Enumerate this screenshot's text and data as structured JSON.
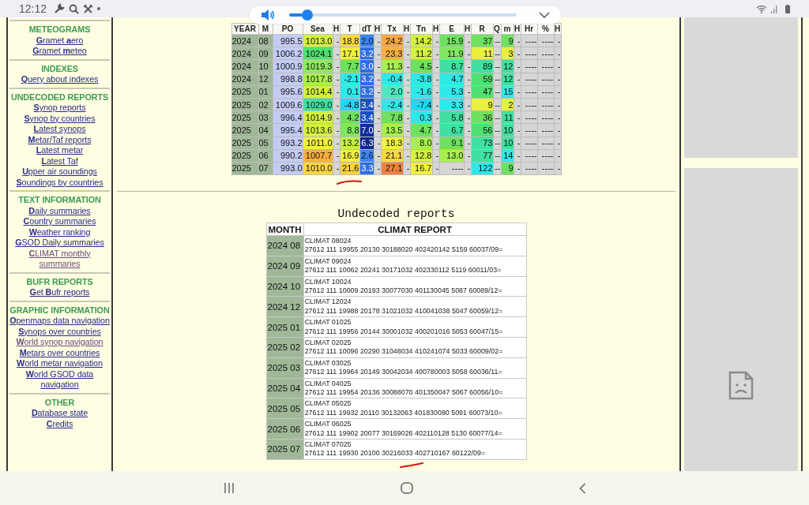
{
  "status_bar": {
    "time": "12:12"
  },
  "volume_popup": {
    "level": 0.06
  },
  "sidebar": {
    "sections": [
      {
        "title": "METEOGRAMS",
        "links": [
          {
            "text": "**G**ramet **a**ero",
            "visited": false
          },
          {
            "text": "**G**ramet **m**eteo",
            "visited": false
          }
        ]
      },
      {
        "title": "INDEXES",
        "links": [
          {
            "text": "**Q**uery about indexes",
            "visited": false
          }
        ]
      },
      {
        "title": "UNDECODED REPORTS",
        "links": [
          {
            "text": "**S**ynop reports",
            "visited": false
          },
          {
            "text": "**S**ynop by countries",
            "visited": false
          },
          {
            "text": "**L**atest synops",
            "visited": false
          },
          {
            "text": "**M**etar/Taf reports",
            "visited": false
          },
          {
            "text": "**L**atest metar",
            "visited": false
          },
          {
            "text": "**L**atest Taf",
            "visited": false
          },
          {
            "text": "**U**pper air soundings",
            "visited": false
          },
          {
            "text": "**S**oundings by countries",
            "visited": false
          }
        ]
      },
      {
        "title": "TEXT INFORMATION",
        "links": [
          {
            "text": "**D**aily summaries",
            "visited": false
          },
          {
            "text": "**C**ountry summaries",
            "visited": false
          },
          {
            "text": "**W**eather ranking",
            "visited": false
          },
          {
            "text": "**G**SOD Daily summaries",
            "visited": false
          },
          {
            "text": "**C**LIMAT monthly summaries",
            "visited": true
          }
        ]
      },
      {
        "title": "BUFR REPORTS",
        "links": [
          {
            "text": "**G**et **B**ufr reports",
            "visited": false
          }
        ]
      },
      {
        "title": "GRAPHIC INFORMATION",
        "links": [
          {
            "text": "**O**penmaps data navigation",
            "visited": false
          },
          {
            "text": "**S**ynops over countries",
            "visited": false
          },
          {
            "text": "**W**orld synop navigation",
            "visited": true
          },
          {
            "text": "**M**etars over countries",
            "visited": false
          },
          {
            "text": "**W**orld metar navigation",
            "visited": false
          },
          {
            "text": "**W**orld GSOD data navigation",
            "visited": false
          }
        ]
      },
      {
        "title": "OTHER",
        "links": [
          {
            "text": "**D**atabase state",
            "visited": false
          },
          {
            "text": "**C**redits",
            "visited": false
          }
        ]
      }
    ]
  },
  "climate_table": {
    "columns": [
      "YEAR",
      "M",
      "PO",
      "Sea",
      "H",
      "T",
      "dT",
      "H",
      "Tx",
      "H",
      "Tn",
      "H",
      "E",
      "H",
      "R",
      "Q",
      "m",
      "H",
      "Hr",
      "%",
      "H"
    ],
    "rows": [
      {
        "cells": [
          {
            "text": "2024",
            "color": "#a0b898"
          },
          {
            "text": "08",
            "color": "#a0b898"
          },
          {
            "text": "995.5",
            "color": "#c4ccf4"
          },
          {
            "text": "1013.0",
            "color": "#d4f040"
          },
          {
            "text": "-",
            "color": "#d6d6d6"
          },
          {
            "text": "18.8",
            "color": "#f8d840"
          },
          {
            "text": "2.0",
            "color": "#3a86f0"
          },
          {
            "text": "-",
            "color": "#d6d6d6"
          },
          {
            "text": "24.2",
            "color": "#f8a840"
          },
          {
            "text": "-",
            "color": "#d6d6d6"
          },
          {
            "text": "14.2",
            "color": "#d4f040"
          },
          {
            "text": "-",
            "color": "#d6d6d6"
          },
          {
            "text": "15.9",
            "color": "#70e060"
          },
          {
            "text": "-",
            "color": "#d6d6d6"
          },
          {
            "text": "37",
            "color": "#70e060"
          },
          {
            "text": "--",
            "color": "#d6d6d6"
          },
          {
            "text": "9",
            "color": "#70e060"
          },
          {
            "text": "-",
            "color": "#d6d6d6"
          },
          {
            "text": "----",
            "color": "#d6d6d6"
          },
          {
            "text": "----",
            "color": "#d6d6d6"
          },
          {
            "text": "-",
            "color": "#d6d6d6"
          }
        ]
      },
      {
        "cells": [
          {
            "text": "2024",
            "color": "#a0b898"
          },
          {
            "text": "09",
            "color": "#a0b898"
          },
          {
            "text": "1006.2",
            "color": "#c4ccf4"
          },
          {
            "text": "1024.1",
            "color": "#50e070"
          },
          {
            "text": "-",
            "color": "#d6d6d6"
          },
          {
            "text": "17.1",
            "color": "#f0f040"
          },
          {
            "text": "3.2",
            "color": "#2f6ee0"
          },
          {
            "text": "-",
            "color": "#d6d6d6"
          },
          {
            "text": "23.3",
            "color": "#f8b040"
          },
          {
            "text": "-",
            "color": "#d6d6d6"
          },
          {
            "text": "11.2",
            "color": "#d4f040"
          },
          {
            "text": "-",
            "color": "#d6d6d6"
          },
          {
            "text": "11.9",
            "color": "#80e860"
          },
          {
            "text": "-",
            "color": "#d6d6d6"
          },
          {
            "text": "11",
            "color": "#e8f040"
          },
          {
            "text": "--",
            "color": "#d6d6d6"
          },
          {
            "text": "3",
            "color": "#e8f040"
          },
          {
            "text": "-",
            "color": "#d6d6d6"
          },
          {
            "text": "----",
            "color": "#d6d6d6"
          },
          {
            "text": "----",
            "color": "#d6d6d6"
          },
          {
            "text": "-",
            "color": "#d6d6d6"
          }
        ]
      },
      {
        "cells": [
          {
            "text": "2024",
            "color": "#a0b898"
          },
          {
            "text": "10",
            "color": "#a0b898"
          },
          {
            "text": "1000.9",
            "color": "#c4ccf4"
          },
          {
            "text": "1019.3",
            "color": "#90e860"
          },
          {
            "text": "-",
            "color": "#d6d6d6"
          },
          {
            "text": "7.7",
            "color": "#70e060"
          },
          {
            "text": "3.0",
            "color": "#2f6ee0"
          },
          {
            "text": "-",
            "color": "#d6d6d6"
          },
          {
            "text": "11.3",
            "color": "#a8f050"
          },
          {
            "text": "-",
            "color": "#d6d6d6"
          },
          {
            "text": "4.5",
            "color": "#70e060"
          },
          {
            "text": "-",
            "color": "#d6d6d6"
          },
          {
            "text": "8.7",
            "color": "#40e0a0"
          },
          {
            "text": "-",
            "color": "#d6d6d6"
          },
          {
            "text": "89",
            "color": "#40e0a0"
          },
          {
            "text": "--",
            "color": "#d6d6d6"
          },
          {
            "text": "12",
            "color": "#40e0a0"
          },
          {
            "text": "-",
            "color": "#d6d6d6"
          },
          {
            "text": "----",
            "color": "#d6d6d6"
          },
          {
            "text": "----",
            "color": "#d6d6d6"
          },
          {
            "text": "-",
            "color": "#d6d6d6"
          }
        ]
      },
      {
        "cells": [
          {
            "text": "2024",
            "color": "#a0b898"
          },
          {
            "text": "12",
            "color": "#a0b898"
          },
          {
            "text": "998.8",
            "color": "#c4ccf4"
          },
          {
            "text": "1017.8",
            "color": "#a8f050"
          },
          {
            "text": "-",
            "color": "#d6d6d6"
          },
          {
            "text": "-2.1",
            "color": "#30e8e8"
          },
          {
            "text": "3.2",
            "color": "#2f6ee0"
          },
          {
            "text": "-",
            "color": "#d6d6d6"
          },
          {
            "text": "-0.4",
            "color": "#30e8e8"
          },
          {
            "text": "-",
            "color": "#d6d6d6"
          },
          {
            "text": "-3.8",
            "color": "#30e8e8"
          },
          {
            "text": "-",
            "color": "#d6d6d6"
          },
          {
            "text": "4.7",
            "color": "#30e8e8"
          },
          {
            "text": "-",
            "color": "#d6d6d6"
          },
          {
            "text": "59",
            "color": "#50e070"
          },
          {
            "text": "--",
            "color": "#d6d6d6"
          },
          {
            "text": "12",
            "color": "#40e0a0"
          },
          {
            "text": "-",
            "color": "#d6d6d6"
          },
          {
            "text": "----",
            "color": "#d6d6d6"
          },
          {
            "text": "----",
            "color": "#d6d6d6"
          },
          {
            "text": "-",
            "color": "#d6d6d6"
          }
        ]
      },
      {
        "cells": [
          {
            "text": "2025",
            "color": "#a0b898"
          },
          {
            "text": "01",
            "color": "#a0b898"
          },
          {
            "text": "995.6",
            "color": "#c4ccf4"
          },
          {
            "text": "1014.4",
            "color": "#d4f040"
          },
          {
            "text": "-",
            "color": "#d6d6d6"
          },
          {
            "text": "0.1",
            "color": "#30e8e8"
          },
          {
            "text": "3.2",
            "color": "#2f6ee0"
          },
          {
            "text": "-",
            "color": "#d6d6d6"
          },
          {
            "text": "2.0",
            "color": "#50e8c0"
          },
          {
            "text": "-",
            "color": "#d6d6d6"
          },
          {
            "text": "-1.6",
            "color": "#30e8e8"
          },
          {
            "text": "-",
            "color": "#d6d6d6"
          },
          {
            "text": "5.3",
            "color": "#30e8e8"
          },
          {
            "text": "-",
            "color": "#d6d6d6"
          },
          {
            "text": "47",
            "color": "#50e070"
          },
          {
            "text": "--",
            "color": "#d6d6d6"
          },
          {
            "text": "15",
            "color": "#30e8e8"
          },
          {
            "text": "-",
            "color": "#d6d6d6"
          },
          {
            "text": "----",
            "color": "#d6d6d6"
          },
          {
            "text": "----",
            "color": "#d6d6d6"
          },
          {
            "text": "-",
            "color": "#d6d6d6"
          }
        ]
      },
      {
        "cells": [
          {
            "text": "2025",
            "color": "#a0b898"
          },
          {
            "text": "02",
            "color": "#a0b898"
          },
          {
            "text": "1009.6",
            "color": "#c4ccf4"
          },
          {
            "text": "1029.0",
            "color": "#40e0a0"
          },
          {
            "text": "-",
            "color": "#d6d6d6"
          },
          {
            "text": "-4.8",
            "color": "#20d8f0"
          },
          {
            "text": "3.4",
            "color": "#1c4fc0"
          },
          {
            "text": "-",
            "color": "#d6d6d6"
          },
          {
            "text": "-2.4",
            "color": "#30e8e8"
          },
          {
            "text": "-",
            "color": "#d6d6d6"
          },
          {
            "text": "-7.4",
            "color": "#20d8f0"
          },
          {
            "text": "-",
            "color": "#d6d6d6"
          },
          {
            "text": "3.3",
            "color": "#30e8e8"
          },
          {
            "text": "-",
            "color": "#d6d6d6"
          },
          {
            "text": "9",
            "color": "#e8f040"
          },
          {
            "text": "--",
            "color": "#d6d6d6"
          },
          {
            "text": "2",
            "color": "#e8f040"
          },
          {
            "text": "-",
            "color": "#d6d6d6"
          },
          {
            "text": "----",
            "color": "#d6d6d6"
          },
          {
            "text": "----",
            "color": "#d6d6d6"
          },
          {
            "text": "-",
            "color": "#d6d6d6"
          }
        ]
      },
      {
        "cells": [
          {
            "text": "2025",
            "color": "#a0b898"
          },
          {
            "text": "03",
            "color": "#a0b898"
          },
          {
            "text": "996.4",
            "color": "#c4ccf4"
          },
          {
            "text": "1014.9",
            "color": "#d4f040"
          },
          {
            "text": "-",
            "color": "#d6d6d6"
          },
          {
            "text": "4.2",
            "color": "#70e060"
          },
          {
            "text": "3.4",
            "color": "#1c4fc0"
          },
          {
            "text": "-",
            "color": "#d6d6d6"
          },
          {
            "text": "7.8",
            "color": "#70e060"
          },
          {
            "text": "-",
            "color": "#d6d6d6"
          },
          {
            "text": "0.3",
            "color": "#30e8e8"
          },
          {
            "text": "-",
            "color": "#d6d6d6"
          },
          {
            "text": "5.8",
            "color": "#40e0a0"
          },
          {
            "text": "-",
            "color": "#d6d6d6"
          },
          {
            "text": "36",
            "color": "#70e060"
          },
          {
            "text": "--",
            "color": "#d6d6d6"
          },
          {
            "text": "11",
            "color": "#40e0a0"
          },
          {
            "text": "-",
            "color": "#d6d6d6"
          },
          {
            "text": "----",
            "color": "#d6d6d6"
          },
          {
            "text": "----",
            "color": "#d6d6d6"
          },
          {
            "text": "-",
            "color": "#d6d6d6"
          }
        ]
      },
      {
        "cells": [
          {
            "text": "2025",
            "color": "#a0b898"
          },
          {
            "text": "04",
            "color": "#a0b898"
          },
          {
            "text": "995.4",
            "color": "#c4ccf4"
          },
          {
            "text": "1013.6",
            "color": "#d4f040"
          },
          {
            "text": "-",
            "color": "#d6d6d6"
          },
          {
            "text": "8.8",
            "color": "#80e860"
          },
          {
            "text": "7.0",
            "color": "#102e98"
          },
          {
            "text": "-",
            "color": "#d6d6d6"
          },
          {
            "text": "13.5",
            "color": "#a8f050"
          },
          {
            "text": "-",
            "color": "#d6d6d6"
          },
          {
            "text": "4.7",
            "color": "#70e060"
          },
          {
            "text": "-",
            "color": "#d6d6d6"
          },
          {
            "text": "6.7",
            "color": "#40e0a0"
          },
          {
            "text": "-",
            "color": "#d6d6d6"
          },
          {
            "text": "56",
            "color": "#50e070"
          },
          {
            "text": "--",
            "color": "#d6d6d6"
          },
          {
            "text": "10",
            "color": "#40e0a0"
          },
          {
            "text": "-",
            "color": "#d6d6d6"
          },
          {
            "text": "----",
            "color": "#d6d6d6"
          },
          {
            "text": "----",
            "color": "#d6d6d6"
          },
          {
            "text": "-",
            "color": "#d6d6d6"
          }
        ]
      },
      {
        "cells": [
          {
            "text": "2025",
            "color": "#a0b898"
          },
          {
            "text": "05",
            "color": "#a0b898"
          },
          {
            "text": "993.2",
            "color": "#c4ccf4"
          },
          {
            "text": "1011.0",
            "color": "#f0f040"
          },
          {
            "text": "-",
            "color": "#d6d6d6"
          },
          {
            "text": "13.2",
            "color": "#c4f048"
          },
          {
            "text": "6.3",
            "color": "#0f2a88"
          },
          {
            "text": "-",
            "color": "#d6d6d6"
          },
          {
            "text": "18.3",
            "color": "#f0f040"
          },
          {
            "text": "-",
            "color": "#d6d6d6"
          },
          {
            "text": "8.0",
            "color": "#a8f050"
          },
          {
            "text": "-",
            "color": "#d6d6d6"
          },
          {
            "text": "9.1",
            "color": "#70e060"
          },
          {
            "text": "-",
            "color": "#d6d6d6"
          },
          {
            "text": "73",
            "color": "#40e0a0"
          },
          {
            "text": "--",
            "color": "#d6d6d6"
          },
          {
            "text": "10",
            "color": "#40e0a0"
          },
          {
            "text": "-",
            "color": "#d6d6d6"
          },
          {
            "text": "----",
            "color": "#d6d6d6"
          },
          {
            "text": "----",
            "color": "#d6d6d6"
          },
          {
            "text": "-",
            "color": "#d6d6d6"
          }
        ]
      },
      {
        "cells": [
          {
            "text": "2025",
            "color": "#a0b898"
          },
          {
            "text": "06",
            "color": "#a0b898"
          },
          {
            "text": "990.2",
            "color": "#c4ccf4"
          },
          {
            "text": "1007.7",
            "color": "#f8b040"
          },
          {
            "text": "-",
            "color": "#d6d6d6"
          },
          {
            "text": "16.9",
            "color": "#f0f040"
          },
          {
            "text": "2.6",
            "color": "#3a86f0"
          },
          {
            "text": "-",
            "color": "#d6d6d6"
          },
          {
            "text": "21.1",
            "color": "#f8d840"
          },
          {
            "text": "-",
            "color": "#d6d6d6"
          },
          {
            "text": "12.8",
            "color": "#d4f040"
          },
          {
            "text": "-",
            "color": "#d6d6d6"
          },
          {
            "text": "13.0",
            "color": "#a8f050"
          },
          {
            "text": "-",
            "color": "#d6d6d6"
          },
          {
            "text": "77",
            "color": "#40e0a0"
          },
          {
            "text": "--",
            "color": "#d6d6d6"
          },
          {
            "text": "14",
            "color": "#30e8e8"
          },
          {
            "text": "-",
            "color": "#d6d6d6"
          },
          {
            "text": "----",
            "color": "#d6d6d6"
          },
          {
            "text": "----",
            "color": "#d6d6d6"
          },
          {
            "text": "-",
            "color": "#d6d6d6"
          }
        ]
      },
      {
        "cells": [
          {
            "text": "2025",
            "color": "#a0b898"
          },
          {
            "text": "07",
            "color": "#a0b898"
          },
          {
            "text": "993.0",
            "color": "#c4ccf4"
          },
          {
            "text": "1010.0",
            "color": "#f8d840"
          },
          {
            "text": "-",
            "color": "#d6d6d6"
          },
          {
            "text": "21.6",
            "color": "#f8d040"
          },
          {
            "text": "3.3",
            "color": "#2f6ee0"
          },
          {
            "text": "-",
            "color": "#d6d6d6"
          },
          {
            "text": "27.1",
            "color": "#f08040"
          },
          {
            "text": "-",
            "color": "#d6d6d6"
          },
          {
            "text": "16.7",
            "color": "#f0f040"
          },
          {
            "text": "-",
            "color": "#d6d6d6"
          },
          {
            "text": "----",
            "color": "#d6d6d6"
          },
          {
            "text": "-",
            "color": "#d6d6d6"
          },
          {
            "text": "122",
            "color": "#30e8e8"
          },
          {
            "text": "--",
            "color": "#d6d6d6"
          },
          {
            "text": "9",
            "color": "#70e060"
          },
          {
            "text": "-",
            "color": "#d6d6d6"
          },
          {
            "text": "----",
            "color": "#d6d6d6"
          },
          {
            "text": "----",
            "color": "#d6d6d6"
          },
          {
            "text": "-",
            "color": "#d6d6d6"
          }
        ]
      }
    ]
  },
  "undecoded_reports": {
    "title": "Undecoded reports",
    "columns": [
      "MONTH",
      "CLIMAT REPORT"
    ],
    "rows": [
      {
        "month": "2024 08",
        "lines": [
          "CLIMAT 08024",
          "27612 111 19955 20130 30188020 402420142 5159 60037/09="
        ]
      },
      {
        "month": "2024 09",
        "lines": [
          "CLIMAT 09024",
          "27612 111 10062 20241 30171032 402330112 5119 60011/03="
        ]
      },
      {
        "month": "2024 10",
        "lines": [
          "CLIMAT 10024",
          "27612 111 10009 20193 30077030 401130045 5087 60089/12="
        ]
      },
      {
        "month": "2024 12",
        "lines": [
          "CLIMAT 12024",
          "27612 111 19988 20178 31021032 410041038 5047 60059/12="
        ]
      },
      {
        "month": "2025 01",
        "lines": [
          "CLIMAT 01025",
          "27612 111 19956 20144 30001032 400201016 5053 60047/15="
        ]
      },
      {
        "month": "2025 02",
        "lines": [
          "CLIMAT 02025",
          "27612 111 10096 20290 31048034 410241074 5033 60009/02="
        ]
      },
      {
        "month": "2025 03",
        "lines": [
          "CLIMAT 03025",
          "27612 111 19964 20149 30042034 400780003 5058 60036/11="
        ]
      },
      {
        "month": "2025 04",
        "lines": [
          "CLIMAT 04025",
          "27612 111 19954 20136 30088070 401350047 5067 60056/10="
        ]
      },
      {
        "month": "2025 05",
        "lines": [
          "CLIMAT 05025",
          "27612 111 19932 20110 30132063 401830080 5091 60073/10="
        ]
      },
      {
        "month": "2025 06",
        "lines": [
          "CLIMAT 06025",
          "27612 111 19902 20077 30169026 402110128 5130 60077/14="
        ]
      },
      {
        "month": "2025 07",
        "lines": [
          "CLIMAT 07025",
          "27612 111 19930 20100 30216033 402710167 60122/09="
        ]
      }
    ]
  }
}
